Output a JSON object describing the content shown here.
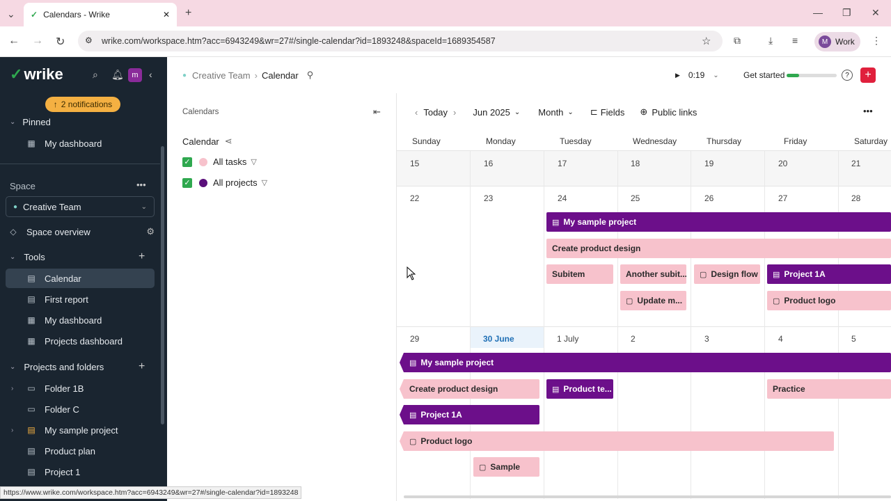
{
  "browser": {
    "tab_title": "Calendars - Wrike",
    "url": "wrike.com/workspace.htm?acc=6943249&wr=27#/single-calendar?id=1893248&spaceId=1689354587",
    "profile": "Work",
    "profile_initial": "M",
    "status_url": "https://www.wrike.com/workspace.htm?acc=6943249&wr=27#/single-calendar?id=1893248"
  },
  "sidebar": {
    "logo": "wrike",
    "notifications": "2 notifications",
    "pinned_label": "Pinned",
    "pinned_items": [
      "My dashboard"
    ],
    "space_label": "Space",
    "space_selected": "Creative Team",
    "space_overview": "Space overview",
    "tools_label": "Tools",
    "tools": [
      "Calendar",
      "First report",
      "My dashboard",
      "Projects dashboard"
    ],
    "projects_label": "Projects and folders",
    "projects": [
      "Folder 1B",
      "Folder C",
      "My sample project",
      "Product plan",
      "Project 1"
    ]
  },
  "header": {
    "breadcrumb_space": "Creative Team",
    "breadcrumb_page": "Calendar",
    "timer": "0:19",
    "get_started": "Get started",
    "progress": 0.25
  },
  "left_panel": {
    "title": "Calendars",
    "calendar_name": "Calendar",
    "layers": [
      {
        "label": "All tasks",
        "color": "#f7c2cc"
      },
      {
        "label": "All projects",
        "color": "#5a0f7a"
      }
    ]
  },
  "toolbar": {
    "today": "Today",
    "month_label": "Jun 2025",
    "view": "Month",
    "fields": "Fields",
    "public_links": "Public links"
  },
  "calendar": {
    "weekdays": [
      "Sunday",
      "Monday",
      "Tuesday",
      "Wednesday",
      "Thursday",
      "Friday",
      "Saturday"
    ],
    "week1": [
      "15",
      "16",
      "17",
      "18",
      "19",
      "20",
      "21"
    ],
    "week2": [
      "22",
      "23",
      "24",
      "25",
      "26",
      "27",
      "28"
    ],
    "week3": [
      "29",
      "30 June",
      "1 July",
      "2",
      "3",
      "4",
      "5"
    ],
    "events": {
      "w2_project": "My sample project",
      "w2_design": "Create product design",
      "w2_subitem": "Subitem",
      "w2_another": "Another subit...",
      "w2_flow": "Design flow",
      "w2_proj1a": "Project 1A",
      "w2_update": "Update m...",
      "w2_logo": "Product logo",
      "w3_project": "My sample project",
      "w3_design": "Create product design",
      "w3_productte": "Product te...",
      "w3_practice": "Practice",
      "w3_proj1a": "Project 1A",
      "w3_logo": "Product logo",
      "w3_sample": "Sample"
    }
  }
}
